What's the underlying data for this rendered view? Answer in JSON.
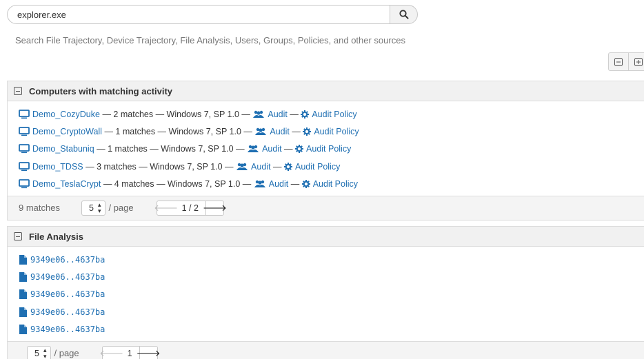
{
  "search": {
    "value": "explorer.exe",
    "hint": "Search File Trajectory, Device Trajectory, File Analysis, Users, Groups, Policies, and other sources"
  },
  "toolbar": {
    "collapse_all_icon": "collapse-all-icon",
    "expand_all_icon": "expand-all-icon"
  },
  "computers_panel": {
    "title": "Computers with matching activity",
    "rows": [
      {
        "name": "Demo_CozyDuke",
        "detail": "— 2 matches — Windows 7, SP 1.0 —",
        "audit": "Audit",
        "sep": "—",
        "policy": "Audit Policy"
      },
      {
        "name": "Demo_CryptoWall",
        "detail": "— 1 matches — Windows 7, SP 1.0 —",
        "audit": "Audit",
        "sep": "—",
        "policy": "Audit Policy"
      },
      {
        "name": "Demo_Stabuniq",
        "detail": "— 1 matches — Windows 7, SP 1.0 —",
        "audit": "Audit",
        "sep": "—",
        "policy": "Audit Policy"
      },
      {
        "name": "Demo_TDSS",
        "detail": "— 3 matches — Windows 7, SP 1.0 —",
        "audit": "Audit",
        "sep": "—",
        "policy": "Audit Policy"
      },
      {
        "name": "Demo_TeslaCrypt",
        "detail": "— 4 matches — Windows 7, SP 1.0 —",
        "audit": "Audit",
        "sep": "—",
        "policy": "Audit Policy"
      }
    ],
    "footer": {
      "count": "9 matches",
      "per_page_value": "5",
      "per_page_label": "/ page",
      "page": "1 / 2"
    }
  },
  "file_panel": {
    "title": "File Analysis",
    "rows": [
      {
        "hash": "9349e06..4637ba"
      },
      {
        "hash": "9349e06..4637ba"
      },
      {
        "hash": "9349e06..4637ba"
      },
      {
        "hash": "9349e06..4637ba"
      },
      {
        "hash": "9349e06..4637ba"
      }
    ],
    "footer": {
      "per_page_value": "5",
      "per_page_label": "/ page",
      "page": "1"
    }
  },
  "colors": {
    "link": "#1f6fb2",
    "panel_header": "#f1f1f1"
  }
}
